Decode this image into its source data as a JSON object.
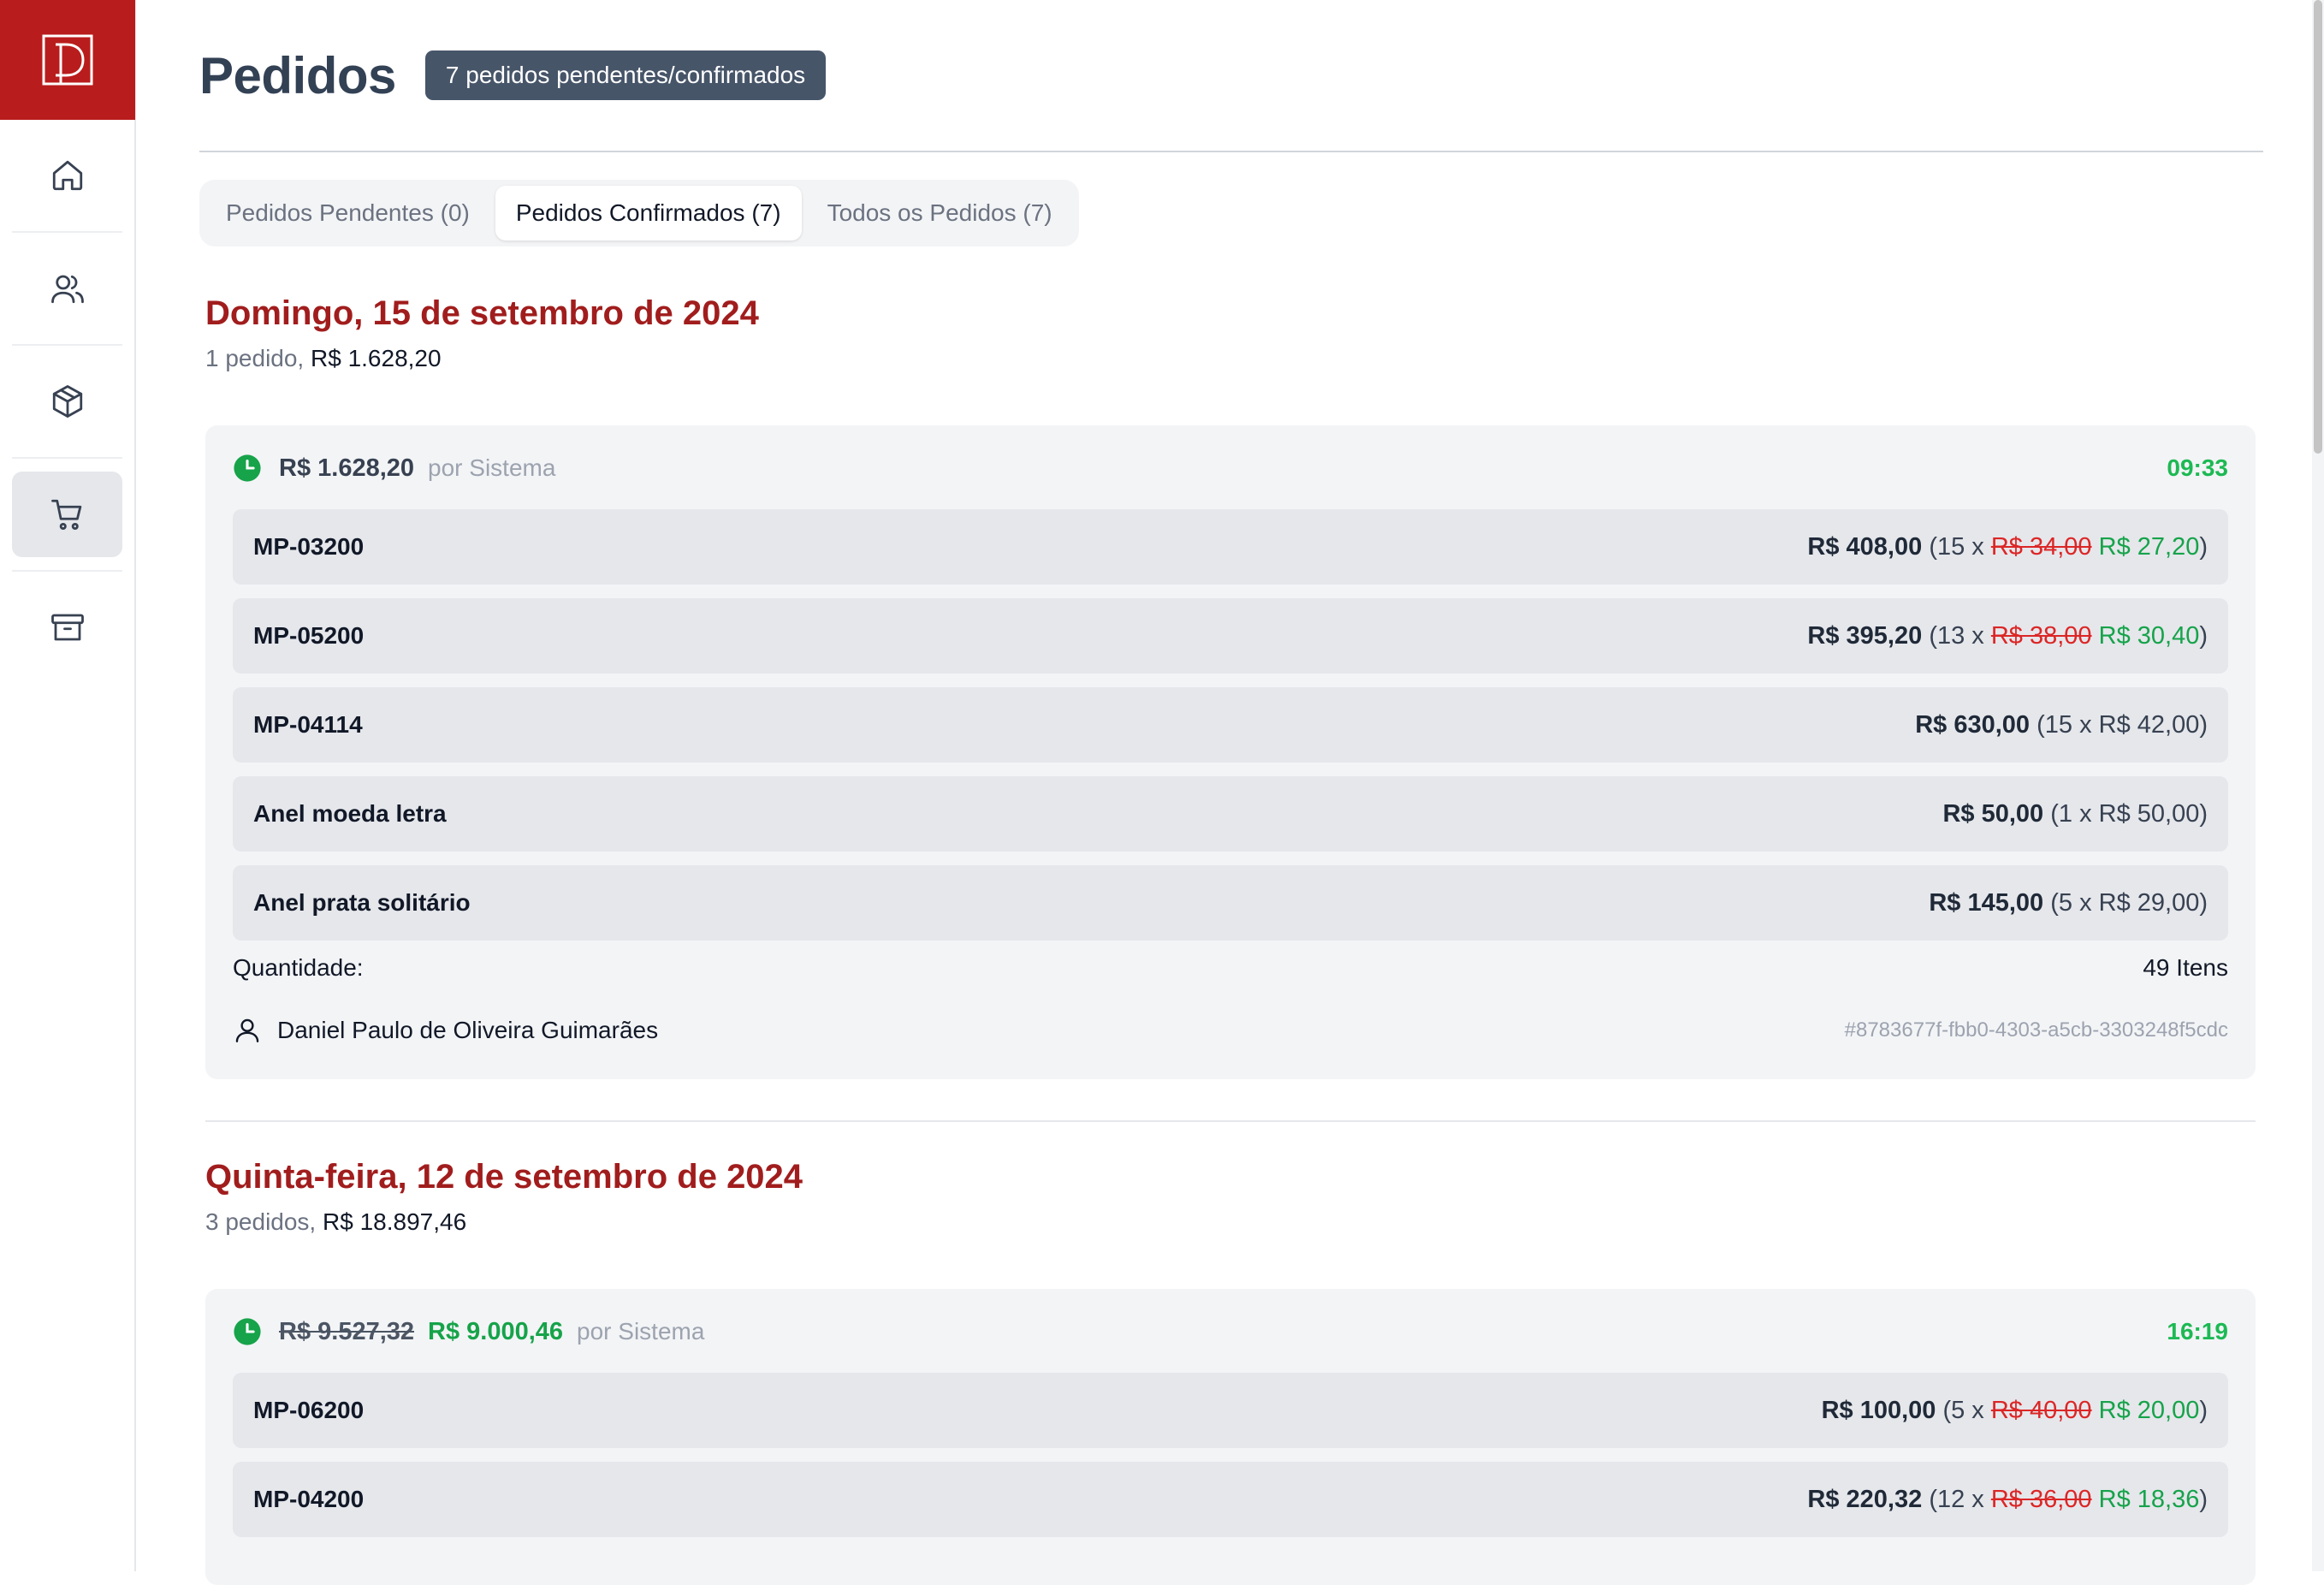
{
  "app": {
    "logo_letter": "D"
  },
  "sidebar": {
    "items": [
      {
        "icon": "home-icon",
        "active": false
      },
      {
        "icon": "users-icon",
        "active": false
      },
      {
        "icon": "package-icon",
        "active": false
      },
      {
        "icon": "cart-icon",
        "active": true
      },
      {
        "icon": "archive-icon",
        "active": false
      }
    ]
  },
  "header": {
    "title": "Pedidos",
    "badge": "7 pedidos pendentes/confirmados"
  },
  "tabs": [
    {
      "label": "Pedidos Pendentes (0)",
      "active": false
    },
    {
      "label": "Pedidos Confirmados (7)",
      "active": true
    },
    {
      "label": "Todos os Pedidos (7)",
      "active": false
    }
  ],
  "days": [
    {
      "title": "Domingo, 15 de setembro de 2024",
      "count": "1 pedido,",
      "total": "R$ 1.628,20",
      "order": {
        "total": "R$ 1.628,20",
        "by": "por Sistema",
        "time": "09:33",
        "items": [
          {
            "name": "MP-03200",
            "total": "R$ 408,00",
            "qty": "(15 x",
            "old_price": "R$ 34,00",
            "price": "R$ 27,20",
            "close": ")"
          },
          {
            "name": "MP-05200",
            "total": "R$ 395,20",
            "qty": "(13 x",
            "old_price": "R$ 38,00",
            "price": "R$ 30,40",
            "close": ")"
          },
          {
            "name": "MP-04114",
            "total": "R$ 630,00",
            "detail": "(15 x R$ 42,00)"
          },
          {
            "name": "Anel moeda letra",
            "total": "R$ 50,00",
            "detail": "(1 x R$ 50,00)"
          },
          {
            "name": "Anel prata solitário",
            "total": "R$ 145,00",
            "detail": "(5 x R$ 29,00)"
          }
        ],
        "qty_label": "Quantidade:",
        "qty_value": "49 Itens",
        "customer": "Daniel Paulo de Oliveira Guimarães",
        "id": "#8783677f-fbb0-4303-a5cb-3303248f5cdc"
      }
    },
    {
      "title": "Quinta-feira, 12 de setembro de 2024",
      "count": "3 pedidos,",
      "total": "R$ 18.897,46",
      "order": {
        "old_total": "R$ 9.527,32",
        "total": "R$ 9.000,46",
        "by": "por Sistema",
        "time": "16:19",
        "items": [
          {
            "name": "MP-06200",
            "total": "R$ 100,00",
            "qty": "(5 x",
            "old_price": "R$ 40,00",
            "price": "R$ 20,00",
            "close": ")"
          },
          {
            "name": "MP-04200",
            "total": "R$ 220,32",
            "qty": "(12 x",
            "old_price": "R$ 36,00",
            "price": "R$ 18,36",
            "close": ")"
          }
        ]
      }
    }
  ],
  "colors": {
    "brand": "#b91c1c",
    "day_title": "#a11d1d",
    "discount": "#16a34a",
    "strike": "#dc2626"
  }
}
